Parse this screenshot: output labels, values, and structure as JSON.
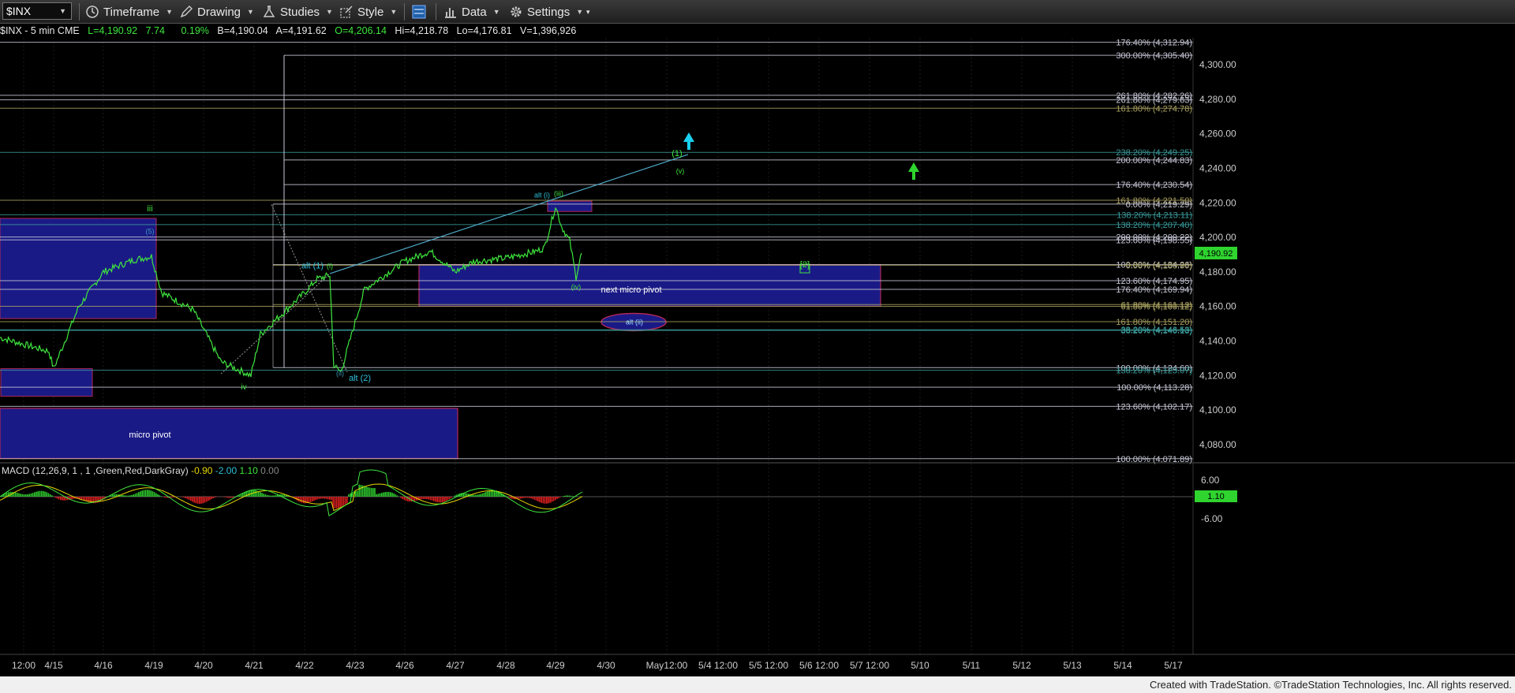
{
  "toolbar": {
    "symbol": "$INX",
    "items": [
      "Timeframe",
      "Drawing",
      "Studies",
      "Style",
      "Data",
      "Settings"
    ]
  },
  "infobar": {
    "symbol_label": "$INX - 5 min  CME",
    "last": "L=4,190.92",
    "change": "7.74",
    "change_pct": "0.19%",
    "bid": "B=4,190.04",
    "ask": "A=4,191.62",
    "open": "O=4,206.14",
    "high": "Hi=4,218.78",
    "low": "Lo=4,176.81",
    "volume": "V=1,396,926"
  },
  "colors": {
    "price": "#3ee63e",
    "fib_white": "#c8c8d8",
    "fib_olive": "#a8a060",
    "fib_teal": "#3a9a9a",
    "box_fill": "#1a1a86",
    "box_border": "#b0285a",
    "macd_line": "#3ee63e",
    "signal_line": "#e6d600",
    "hist_up": "#2ecc2e",
    "hist_down": "#e02020"
  },
  "chart_data": {
    "type": "line",
    "title": "$INX - 5 min",
    "price_axis": {
      "ticks": [
        "4,300.00",
        "4,280.00",
        "4,260.00",
        "4,240.00",
        "4,220.00",
        "4,200.00",
        "4,180.00",
        "4,160.00",
        "4,140.00",
        "4,120.00",
        "4,100.00",
        "4,080.00"
      ],
      "ylim": [
        4065,
        4318
      ]
    },
    "current_price": "4,190.92",
    "time_axis": [
      "12:00",
      "4/15",
      "4/16",
      "4/19",
      "4/20",
      "4/21",
      "4/22",
      "4/23",
      "4/26",
      "4/27",
      "4/28",
      "4/29",
      "4/30",
      "May12:00",
      "5/4 12:00",
      "5/5 12:00",
      "5/6 12:00",
      "5/7 12:00",
      "5/10",
      "5/11",
      "5/12",
      "5/13",
      "5/14",
      "5/17"
    ],
    "series": [
      {
        "name": "$INX",
        "x": [
          "4/14 12:00",
          "4/15",
          "4/15",
          "4/16",
          "4/16",
          "4/19",
          "4/19",
          "4/19",
          "4/20",
          "4/20",
          "4/21",
          "4/21",
          "4/22",
          "4/22",
          "4/22",
          "4/22",
          "4/23",
          "4/23",
          "4/26",
          "4/26",
          "4/27",
          "4/27",
          "4/28",
          "4/28",
          "4/29",
          "4/29",
          "4/29",
          "4/29",
          "4/29",
          "4/29 close"
        ],
        "y": [
          4142,
          4134,
          4124,
          4160,
          4180,
          4187,
          4189,
          4168,
          4158,
          4128,
          4120,
          4144,
          4168,
          4176,
          4178,
          4126,
          4122,
          4170,
          4186,
          4192,
          4180,
          4186,
          4188,
          4192,
          4194,
          4218,
          4206,
          4198,
          4177,
          4190.92
        ]
      }
    ],
    "fib_levels": [
      {
        "label": "176.40% (4,312.94)",
        "value": 4312.94,
        "color": "white"
      },
      {
        "label": "300.00% (4,305.40)",
        "value": 4305.4,
        "color": "white"
      },
      {
        "label": "261.80% (4,282.26)",
        "value": 4282.26,
        "color": "white"
      },
      {
        "label": "261.80% (4,279.63)",
        "value": 4279.63,
        "color": "white"
      },
      {
        "label": "161.80% (4,274.78)",
        "value": 4274.78,
        "color": "olive"
      },
      {
        "label": "238.20% (4,249.25)",
        "value": 4249.25,
        "color": "teal"
      },
      {
        "label": "200.00% (4,244.83)",
        "value": 4244.83,
        "color": "white"
      },
      {
        "label": "176.40% (4,230.54)",
        "value": 4230.54,
        "color": "white"
      },
      {
        "label": "161.80% (4,221.50)",
        "value": 4221.5,
        "color": "olive"
      },
      {
        "label": "0.00% (4,219.29)",
        "value": 4219.29,
        "color": "white"
      },
      {
        "label": "138.20% (4,213.11)",
        "value": 4213.11,
        "color": "teal"
      },
      {
        "label": "138.20% (4,207.40)",
        "value": 4207.4,
        "color": "teal"
      },
      {
        "label": "200.00% (4,200.22)",
        "value": 4200.22,
        "color": "white"
      },
      {
        "label": "123.60% (4,198.55)",
        "value": 4198.55,
        "color": "white"
      },
      {
        "label": "100.00% (4,184.26)",
        "value": 4184.26,
        "color": "white"
      },
      {
        "label": "0.00% (4,183.90)",
        "value": 4183.9,
        "color": "olive"
      },
      {
        "label": "123.60% (4,174.95)",
        "value": 4174.95,
        "color": "white"
      },
      {
        "label": "176.40% (4,169.94)",
        "value": 4169.94,
        "color": "white"
      },
      {
        "label": "61.80% (4,161.12)",
        "value": 4161.12,
        "color": "olive"
      },
      {
        "label": "61.80% (4,160.12)",
        "value": 4160.12,
        "color": "olive"
      },
      {
        "label": "161.80% (4,151.20)",
        "value": 4151.2,
        "color": "olive"
      },
      {
        "label": "38.20% (4,146.53)",
        "value": 4146.53,
        "color": "teal"
      },
      {
        "label": "38.20% (4,146.13)",
        "value": 4146.13,
        "color": "teal"
      },
      {
        "label": "100.00% (4,124.60)",
        "value": 4124.6,
        "color": "white"
      },
      {
        "label": "138.20% (4,123.07)",
        "value": 4123.07,
        "color": "teal"
      },
      {
        "label": "100.00% (4,113.28)",
        "value": 4113.28,
        "color": "white"
      },
      {
        "label": "123.60% (4,102.17)",
        "value": 4102.17,
        "color": "white"
      },
      {
        "label": "100.00% (4,071.89)",
        "value": 4071.89,
        "color": "white"
      }
    ],
    "zones": [
      {
        "label": "next micro pivot",
        "y_top": 4184.26,
        "y_bottom": 4160.12
      },
      {
        "label": "micro pivot",
        "y_top": 4101,
        "y_bottom": 4072
      }
    ],
    "wave_labels": [
      "iii",
      "(5)",
      "iv",
      "alt (1)",
      "(i)",
      "(ii)",
      "alt (2)",
      "alt (i)",
      "(iii)",
      "(iv)",
      "(1)",
      "(v)",
      "[2]",
      "alt (ii)"
    ],
    "macd": {
      "label": "MACD (12,26,9, 1 , 1 ,Green,Red,DarkGray)",
      "values": [
        "-0.90",
        "-2.00",
        "1.10",
        "0.00"
      ],
      "axis_ticks": [
        "6.00",
        "-6.00"
      ],
      "current": "1.10"
    }
  },
  "footer": "Created with TradeStation. ©TradeStation Technologies, Inc. All rights reserved."
}
